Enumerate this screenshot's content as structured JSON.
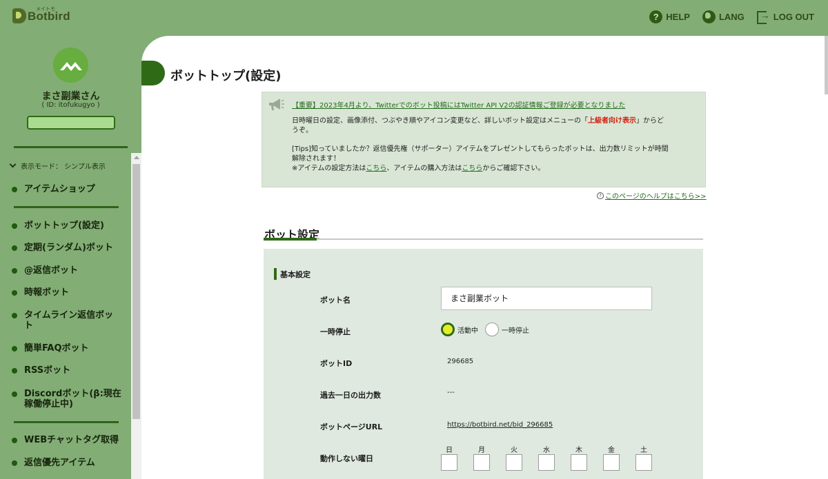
{
  "header": {
    "logo_sub": "メイトモ",
    "logo_name": "Botbird",
    "nav": [
      {
        "label": "HELP",
        "icon": "help-icon"
      },
      {
        "label": "LANG",
        "icon": "globe-icon"
      },
      {
        "label": "LOG OUT",
        "icon": "logout-icon"
      }
    ]
  },
  "user": {
    "name": "まさ副業さん",
    "id_text": "( ID: itofukugyo )"
  },
  "sidebar": {
    "mode_label": "表示モード： シンプル表示",
    "items": [
      "アイテムショップ",
      "ボットトップ(設定)",
      "定期(ランダム)ボット",
      "@返信ボット",
      "時報ボット",
      "タイムライン返信ボット",
      "簡単FAQボット",
      "RSSボット",
      "Discordボット(β:現在稼働停止中)",
      "WEBチャットタグ取得",
      "返信優先アイテム"
    ]
  },
  "page": {
    "title": "ボットトップ(設定)"
  },
  "notice": {
    "headline": "【重要】2023年4月より、Twitterでのボット投稿にはTwitter API V2の認証情報ご登録が必要となりました",
    "p1_before": "日時曜日の設定、画像添付、つぶやき順やアイコン変更など、詳しいボット設定はメニューの「",
    "p1_red": "上級者向け表示",
    "p1_after": "」からど",
    "p1_line2": "うぞ。",
    "tips_line1": "[Tips]知っていましたか？返信優先権（サポーター）アイテムをプレゼントしてもらったボットは、出力数リミットが時間",
    "tips_line2": "解除されます！",
    "tips_line3_a": "※アイテムの設定方法は",
    "tips_link1": "こちら",
    "tips_line3_b": "、アイテムの購入方法は",
    "tips_link2": "こちら",
    "tips_line3_c": "からご確認下さい。"
  },
  "help_link": "このページのヘルプはこちら>>",
  "settings": {
    "section_title": "ボット設定",
    "subsection_title": "基本設定",
    "bot_name_label": "ボット名",
    "bot_name_value": "まさ副業ボット",
    "pause_label": "一時停止",
    "radio_active": "活動中",
    "radio_paused": "一時停止",
    "bot_id_label": "ボットID",
    "bot_id_value": "296685",
    "output_label": "過去一日の出力数",
    "output_value": "---",
    "url_label": "ボットページURL",
    "url_value": "https://botbird.net/bid_296685",
    "days_label": "動作しない曜日",
    "days": [
      "日",
      "月",
      "火",
      "水",
      "木",
      "金",
      "土"
    ]
  },
  "colors": {
    "frame_green": "#82ad75",
    "accent_dark_green": "#2f6a17",
    "notice_bg": "#d9e6d5",
    "form_bg": "#dfe9df",
    "warning_red": "#d2200e"
  }
}
